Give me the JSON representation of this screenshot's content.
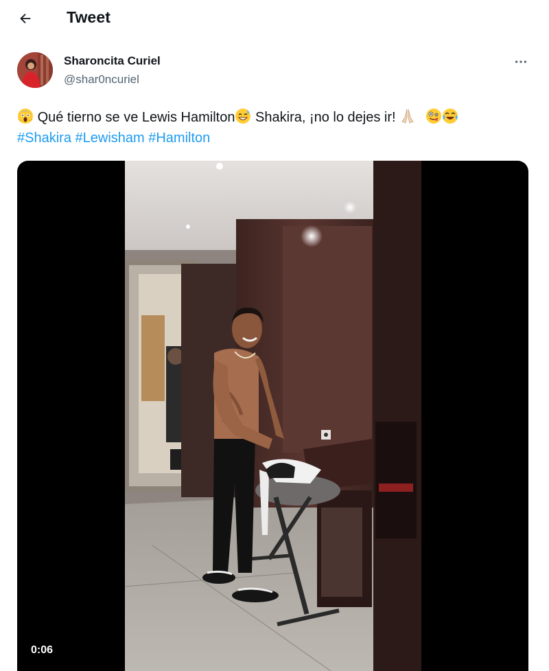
{
  "header": {
    "title": "Tweet",
    "back_icon": "arrow-left-icon"
  },
  "author": {
    "name": "Sharoncita Curiel",
    "handle": "@shar0ncuriel",
    "more_icon": "more-horizontal-icon"
  },
  "tweet": {
    "text_main": "Qué tierno se ve Lewis Hamilton",
    "text_after": " Shakira, ¡no lo dejes ir! ",
    "emojis": [
      "face-screaming-icon",
      "grinning-sweat-icon",
      "folded-hands-icon",
      "zany-face-icon",
      "tears-of-joy-icon"
    ],
    "hashtags": [
      "#Shakira",
      "#Lewisham",
      "#Hamilton"
    ]
  },
  "media": {
    "type": "video",
    "duration": "0:06"
  },
  "colors": {
    "link": "#1d9bf0",
    "secondary": "#536471",
    "text": "#0f1419"
  }
}
